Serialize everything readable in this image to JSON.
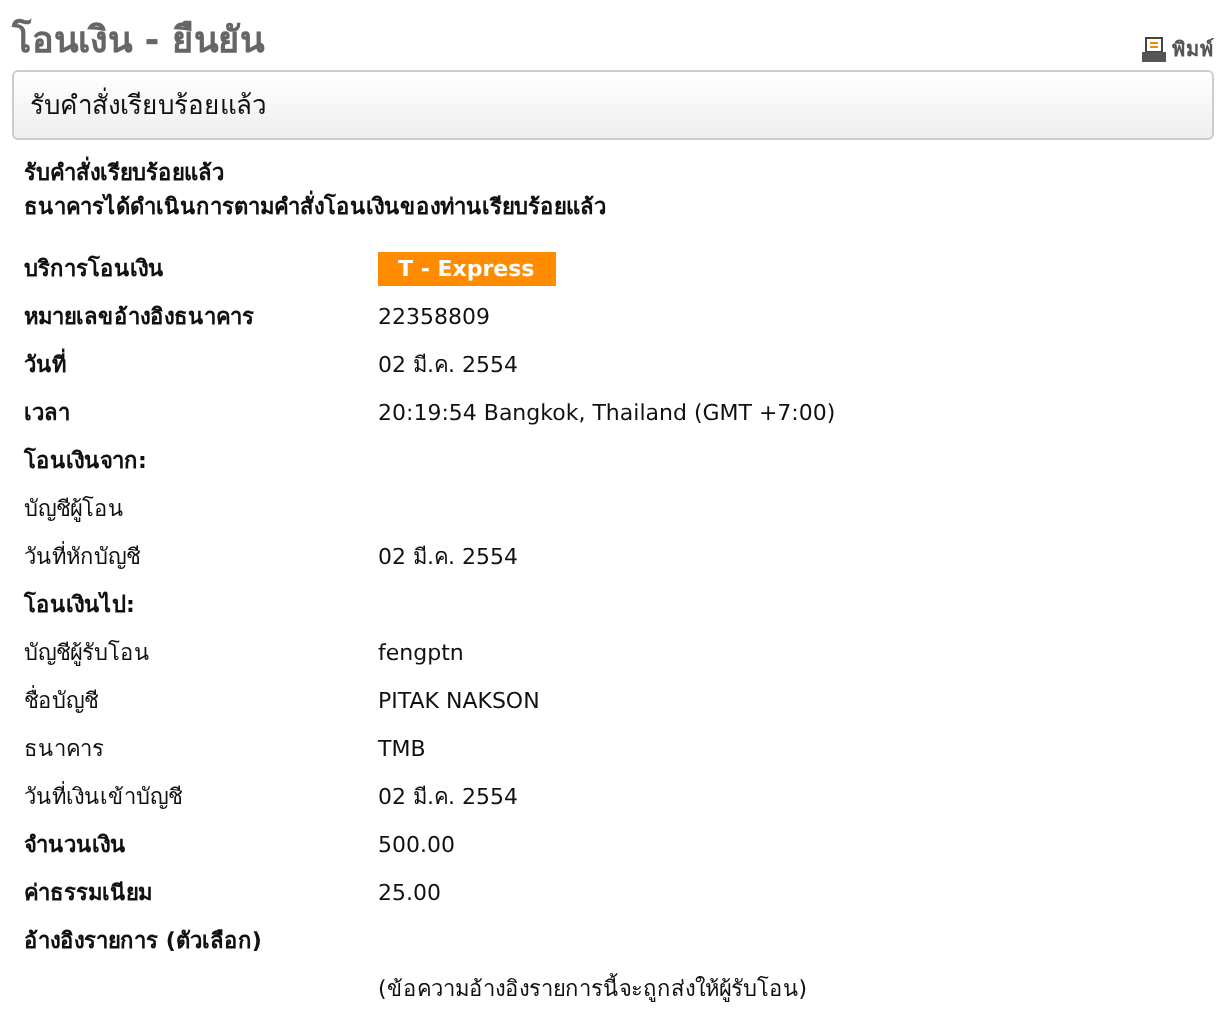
{
  "page_title": "โอนเงิน - ยืนยัน",
  "print_link": "พิมพ์",
  "status_panel": {
    "title": "รับคำสั่งเรียบร้อยแล้ว"
  },
  "messages": [
    "รับคำสั่งเรียบร้อยแล้ว",
    "ธนาคารได้ดำเนินการตามคำสั่งโอนเงินของท่านเรียบร้อยแล้ว"
  ],
  "rows": [
    {
      "kind": "badge",
      "label": "บริการโอนเงิน",
      "bold": true,
      "value": "T - Express"
    },
    {
      "kind": "field",
      "label": "หมายเลขอ้างอิงธนาคาร",
      "bold": true,
      "value": "22358809"
    },
    {
      "kind": "field",
      "label": "วันที่",
      "bold": true,
      "value": "02 มี.ค. 2554"
    },
    {
      "kind": "field",
      "label": "เวลา",
      "bold": true,
      "value": "20:19:54 Bangkok, Thailand (GMT +7:00)"
    },
    {
      "kind": "section",
      "label": "โอนเงินจาก:",
      "bold": true
    },
    {
      "kind": "field",
      "label": "บัญชีผู้โอน",
      "bold": false
    },
    {
      "kind": "field",
      "label": "วันที่หักบัญชี",
      "bold": false,
      "value": "02 มี.ค. 2554"
    },
    {
      "kind": "section",
      "label": "โอนเงินไป:",
      "bold": true
    },
    {
      "kind": "field",
      "label": "บัญชีผู้รับโอน",
      "bold": false,
      "value": "fengptn"
    },
    {
      "kind": "field",
      "label": "ชื่อบัญชี",
      "bold": false,
      "value": "PITAK NAKSON"
    },
    {
      "kind": "field",
      "label": "ธนาคาร",
      "bold": false,
      "value": "TMB"
    },
    {
      "kind": "field",
      "label": "วันที่เงินเข้าบัญชี",
      "bold": false,
      "value": "02 มี.ค. 2554"
    },
    {
      "kind": "field",
      "label": "จำนวนเงิน",
      "bold": true,
      "value": "500.00"
    },
    {
      "kind": "field",
      "label": "ค่าธรรมเนียม",
      "bold": true,
      "value": "25.00"
    },
    {
      "kind": "section",
      "label": "อ้างอิงรายการ (ตัวเลือก)",
      "bold": true
    },
    {
      "kind": "note",
      "value": "(ข้อความอ้างอิงรายการนี้จะถูกส่งให้ผู้รับโอน)"
    }
  ]
}
